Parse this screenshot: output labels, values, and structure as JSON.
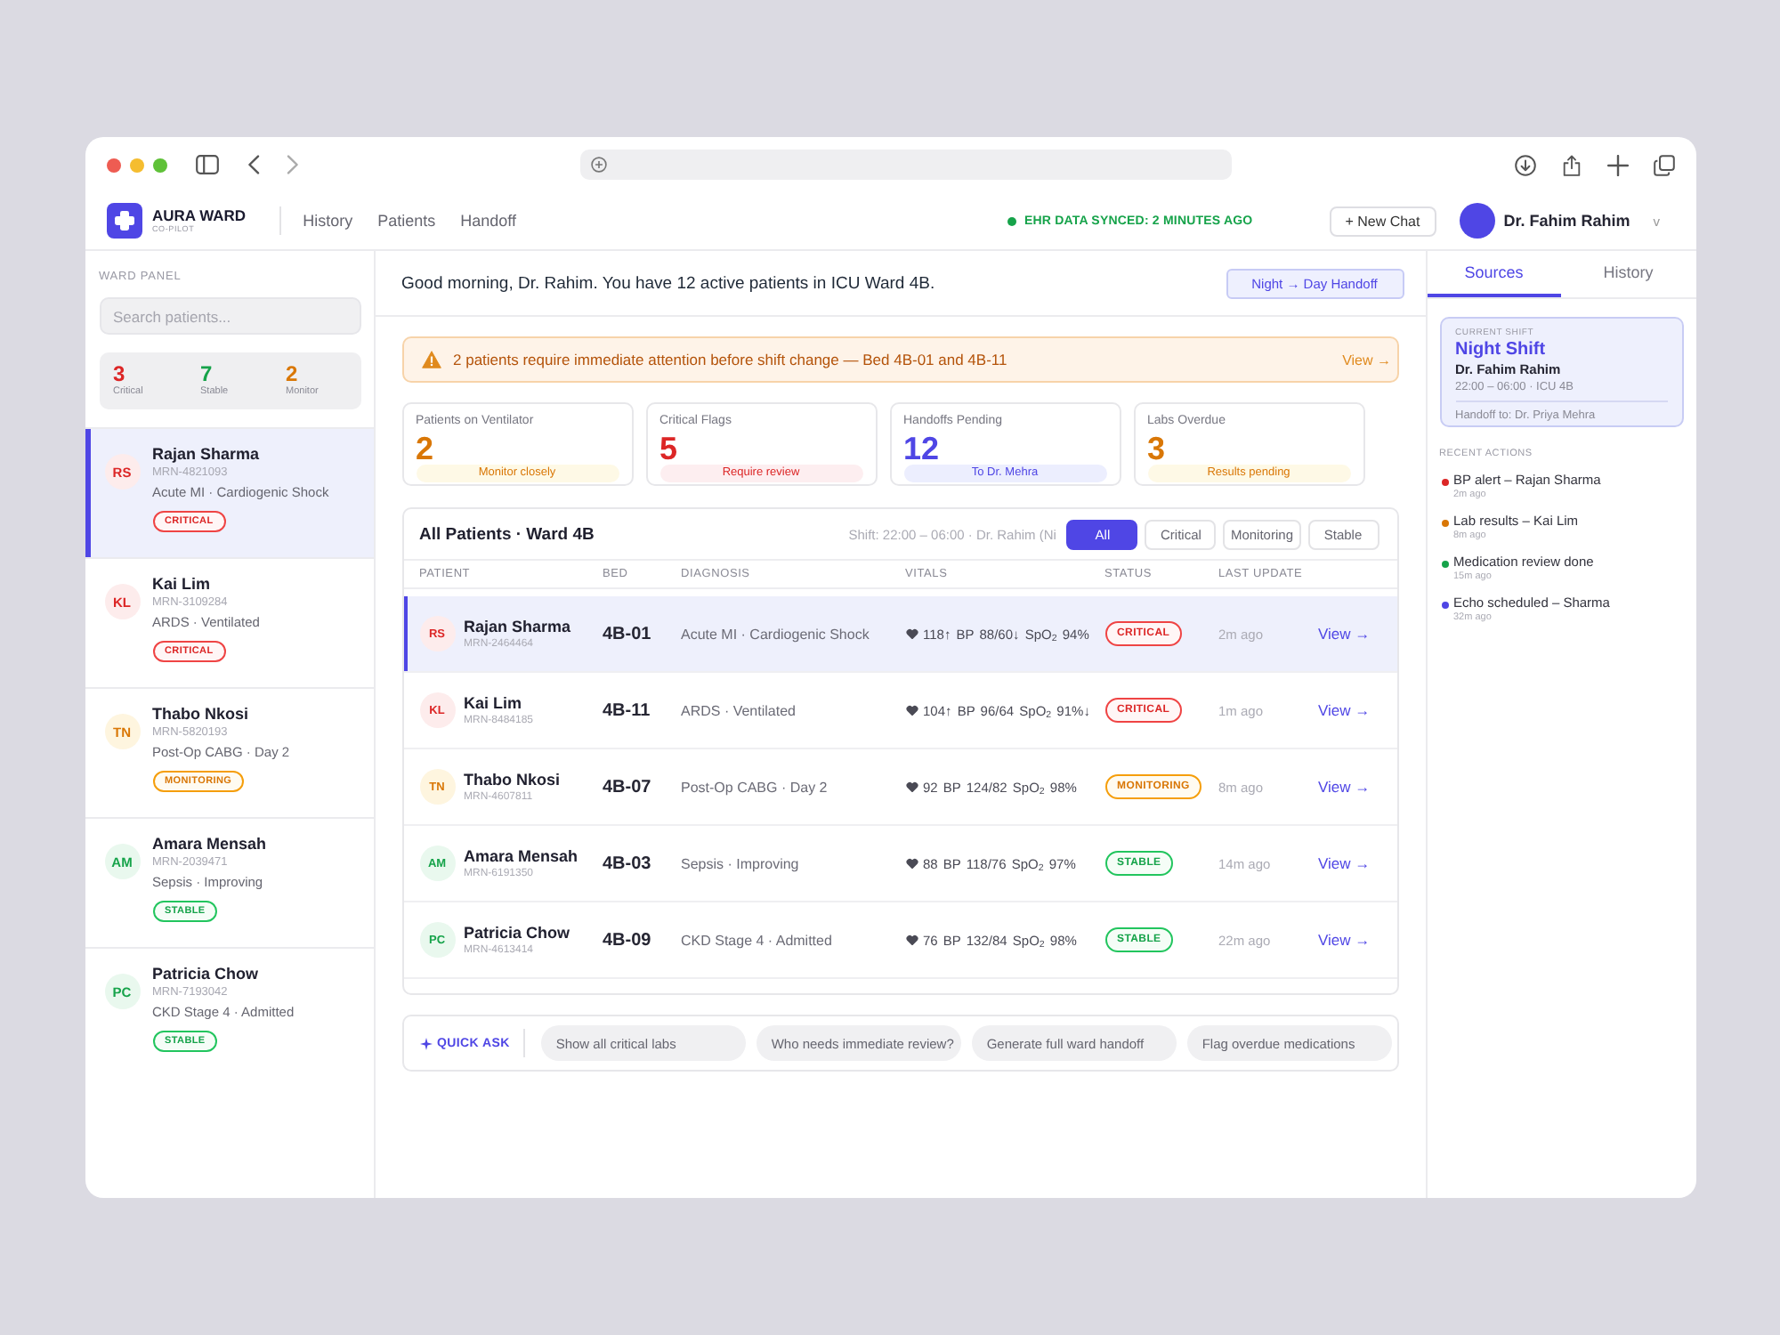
{
  "header": {
    "brand": "AURA WARD",
    "subtitle": "CO-PILOT",
    "nav": [
      "History",
      "Patients",
      "Handoff"
    ],
    "sync_status": "EHR DATA SYNCED: 2 MINUTES AGO",
    "new_chat_button": "+ New Chat",
    "user_name": "Dr. Fahim Rahim",
    "menu_caret": "v"
  },
  "sidebar": {
    "heading": "WARD PANEL",
    "search": {
      "placeholder": "Search patients..."
    },
    "stats": [
      {
        "value": "3",
        "label": "Critical",
        "kind": "critical"
      },
      {
        "value": "7",
        "label": "Stable",
        "kind": "stable"
      },
      {
        "value": "2",
        "label": "Monitor",
        "kind": "monitoring"
      }
    ],
    "patients": [
      {
        "initials": "RS",
        "name": "Rajan Sharma",
        "mrn": "MRN-4821093",
        "diagnosis": "Acute MI · Cardiogenic Shock",
        "status": "CRITICAL",
        "kind": "critical",
        "selected": true
      },
      {
        "initials": "KL",
        "name": "Kai Lim",
        "mrn": "MRN-3109284",
        "diagnosis": "ARDS · Ventilated",
        "status": "CRITICAL",
        "kind": "critical",
        "selected": false
      },
      {
        "initials": "TN",
        "name": "Thabo Nkosi",
        "mrn": "MRN-5820193",
        "diagnosis": "Post-Op CABG · Day 2",
        "status": "MONITORING",
        "kind": "monitoring",
        "selected": false
      },
      {
        "initials": "AM",
        "name": "Amara Mensah",
        "mrn": "MRN-2039471",
        "diagnosis": "Sepsis · Improving",
        "status": "STABLE",
        "kind": "stable",
        "selected": false
      },
      {
        "initials": "PC",
        "name": "Patricia Chow",
        "mrn": "MRN-7193042",
        "diagnosis": "CKD Stage 4 · Admitted",
        "status": "STABLE",
        "kind": "stable",
        "selected": false
      }
    ]
  },
  "main": {
    "greeting": "Good morning, Dr. Rahim. You have 12 active patients in ICU Ward 4B.",
    "handoff_button": "Night → Day Handoff",
    "alert": {
      "text": "2 patients require immediate attention before shift change — Bed 4B-01 and 4B-11",
      "link": "View →"
    },
    "metrics": [
      {
        "label": "Patients on Ventilator",
        "value": "2",
        "note": "Monitor closely",
        "kind": "warning"
      },
      {
        "label": "Critical Flags",
        "value": "5",
        "note": "Require review",
        "kind": "danger"
      },
      {
        "label": "Handoffs Pending",
        "value": "12",
        "note": "To Dr. Mehra",
        "kind": "info"
      },
      {
        "label": "Labs Overdue",
        "value": "3",
        "note": "Results pending",
        "kind": "warning"
      }
    ],
    "table": {
      "title": "All Patients · Ward 4B",
      "shift_note": "Shift: 22:00 – 06:00 · Dr. Rahim (Ni",
      "filters": [
        {
          "label": "All",
          "selected": true
        },
        {
          "label": "Critical",
          "selected": false
        },
        {
          "label": "Monitoring",
          "selected": false
        },
        {
          "label": "Stable",
          "selected": false
        }
      ],
      "columns": [
        "PATIENT",
        "BED",
        "DIAGNOSIS",
        "VITALS",
        "STATUS",
        "LAST UPDATE"
      ],
      "rows": [
        {
          "initials": "RS",
          "name": "Rajan Sharma",
          "mrn": "MRN-2464464",
          "bed": "4B-01",
          "diagnosis": "Acute MI · Cardiogenic Shock",
          "vitals": "118↑ BP 88/60↓ SpO$_{2}$ 94%",
          "status": "CRITICAL",
          "kind": "critical",
          "updated": "2m ago",
          "action": "View →",
          "selected": true
        },
        {
          "initials": "KL",
          "name": "Kai Lim",
          "mrn": "MRN-8484185",
          "bed": "4B-11",
          "diagnosis": "ARDS · Ventilated",
          "vitals": "104↑ BP 96/64 SpO$_{2}$ 91%↓",
          "status": "CRITICAL",
          "kind": "critical",
          "updated": "1m ago",
          "action": "View →",
          "selected": false
        },
        {
          "initials": "TN",
          "name": "Thabo Nkosi",
          "mrn": "MRN-4607811",
          "bed": "4B-07",
          "diagnosis": "Post-Op CABG · Day 2",
          "vitals": "92 BP 124/82 SpO$_{2}$ 98%",
          "status": "MONITORING",
          "kind": "monitoring",
          "updated": "8m ago",
          "action": "View →",
          "selected": false
        },
        {
          "initials": "AM",
          "name": "Amara Mensah",
          "mrn": "MRN-6191350",
          "bed": "4B-03",
          "diagnosis": "Sepsis · Improving",
          "vitals": "88 BP 118/76 SpO$_{2}$ 97%",
          "status": "STABLE",
          "kind": "stable",
          "updated": "14m ago",
          "action": "View →",
          "selected": false
        },
        {
          "initials": "PC",
          "name": "Patricia Chow",
          "mrn": "MRN-4613414",
          "bed": "4B-09",
          "diagnosis": "CKD Stage 4 · Admitted",
          "vitals": "76 BP 132/84 SpO$_{2}$ 98%",
          "status": "STABLE",
          "kind": "stable",
          "updated": "22m ago",
          "action": "View →",
          "selected": false
        }
      ]
    },
    "quick_ask": {
      "label": "QUICK ASK",
      "suggestions": [
        "Show all critical labs",
        "Who needs immediate review?",
        "Generate full ward handoff",
        "Flag overdue medications"
      ]
    }
  },
  "right_panel": {
    "tabs": [
      {
        "label": "Sources",
        "selected": true
      },
      {
        "label": "History",
        "selected": false
      }
    ],
    "shift_card": {
      "heading": "CURRENT SHIFT",
      "title": "Night Shift",
      "doctor": "Dr. Fahim Rahim",
      "hours": "22:00 – 06:00 · ICU 4B",
      "handoff": "Handoff to: Dr. Priya Mehra"
    },
    "recent_heading": "RECENT ACTIONS",
    "actions": [
      {
        "text": "BP alert – Rajan Sharma",
        "time": "2m ago",
        "color": "#dc2626"
      },
      {
        "text": "Lab results – Kai Lim",
        "time": "8m ago",
        "color": "#d97706"
      },
      {
        "text": "Medication review done",
        "time": "15m ago",
        "color": "#16a34a"
      },
      {
        "text": "Echo scheduled – Sharma",
        "time": "32m ago",
        "color": "#4f46e5"
      }
    ]
  }
}
